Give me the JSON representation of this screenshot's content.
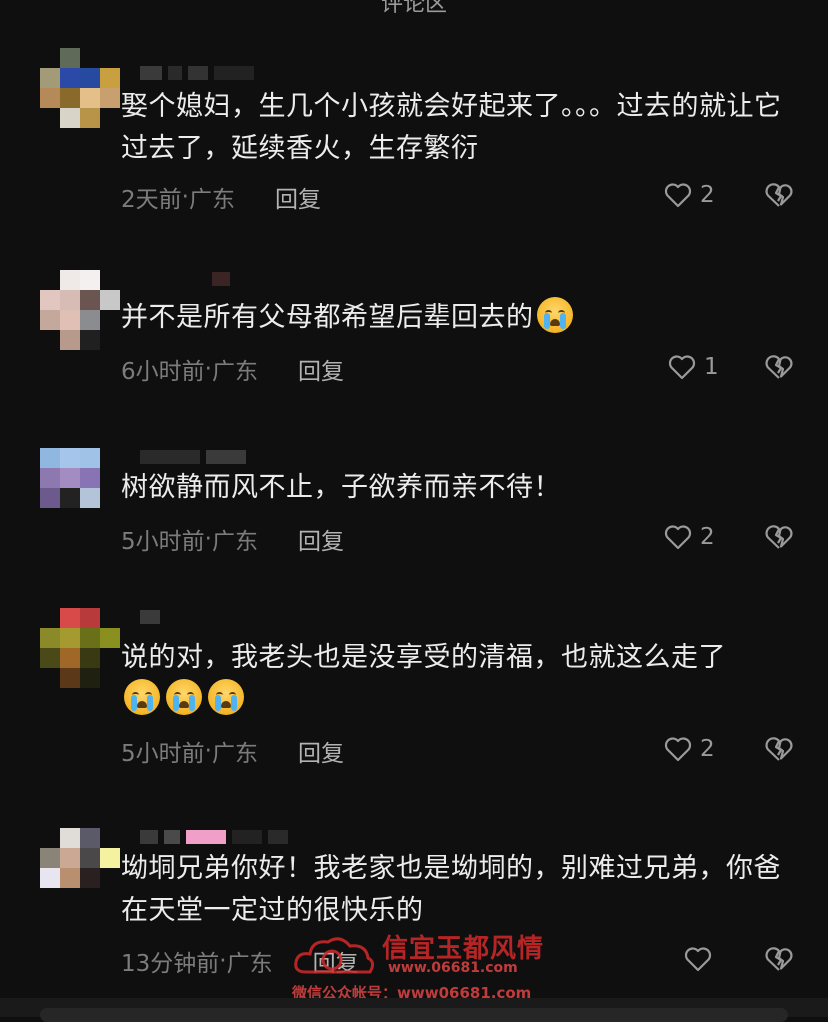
{
  "header": {
    "title": "评论区"
  },
  "comments": [
    {
      "text": "娶个媳妇，生几个小孩就会好起来了。。。过去的就让它过去了，延续香火，生存繁衍",
      "emojis": 0,
      "time": "2天前",
      "location": "广东",
      "reply": "回复",
      "likes": "2"
    },
    {
      "text": "并不是所有父母都希望后辈回去的",
      "emojis": 1,
      "time": "6小时前",
      "location": "广东",
      "reply": "回复",
      "likes": "1"
    },
    {
      "text": "树欲静而风不止，子欲养而亲不待！",
      "emojis": 0,
      "time": "5小时前",
      "location": "广东",
      "reply": "回复",
      "likes": "2"
    },
    {
      "text": "说的对，我老头也是没享受的清福，也就这么走了",
      "emojis": 3,
      "time": "5小时前",
      "location": "广东",
      "reply": "回复",
      "likes": "2"
    },
    {
      "text": "坳垌兄弟你好！我老家也是坳垌的，别难过兄弟，你爸在天堂一定过的很快乐的",
      "emojis": 0,
      "time": "13分钟前",
      "location": "广东",
      "reply": "回复",
      "likes": ""
    }
  ],
  "meta_separator": " · ",
  "watermark": {
    "title": "信宜玉都风情",
    "url": "www.06681.com",
    "wechat": "微信公众帐号：www06681.com"
  },
  "icons": {
    "like": "heart-outline-icon",
    "dislike": "broken-heart-icon",
    "emoji": "loudly-crying-face-emoji"
  }
}
